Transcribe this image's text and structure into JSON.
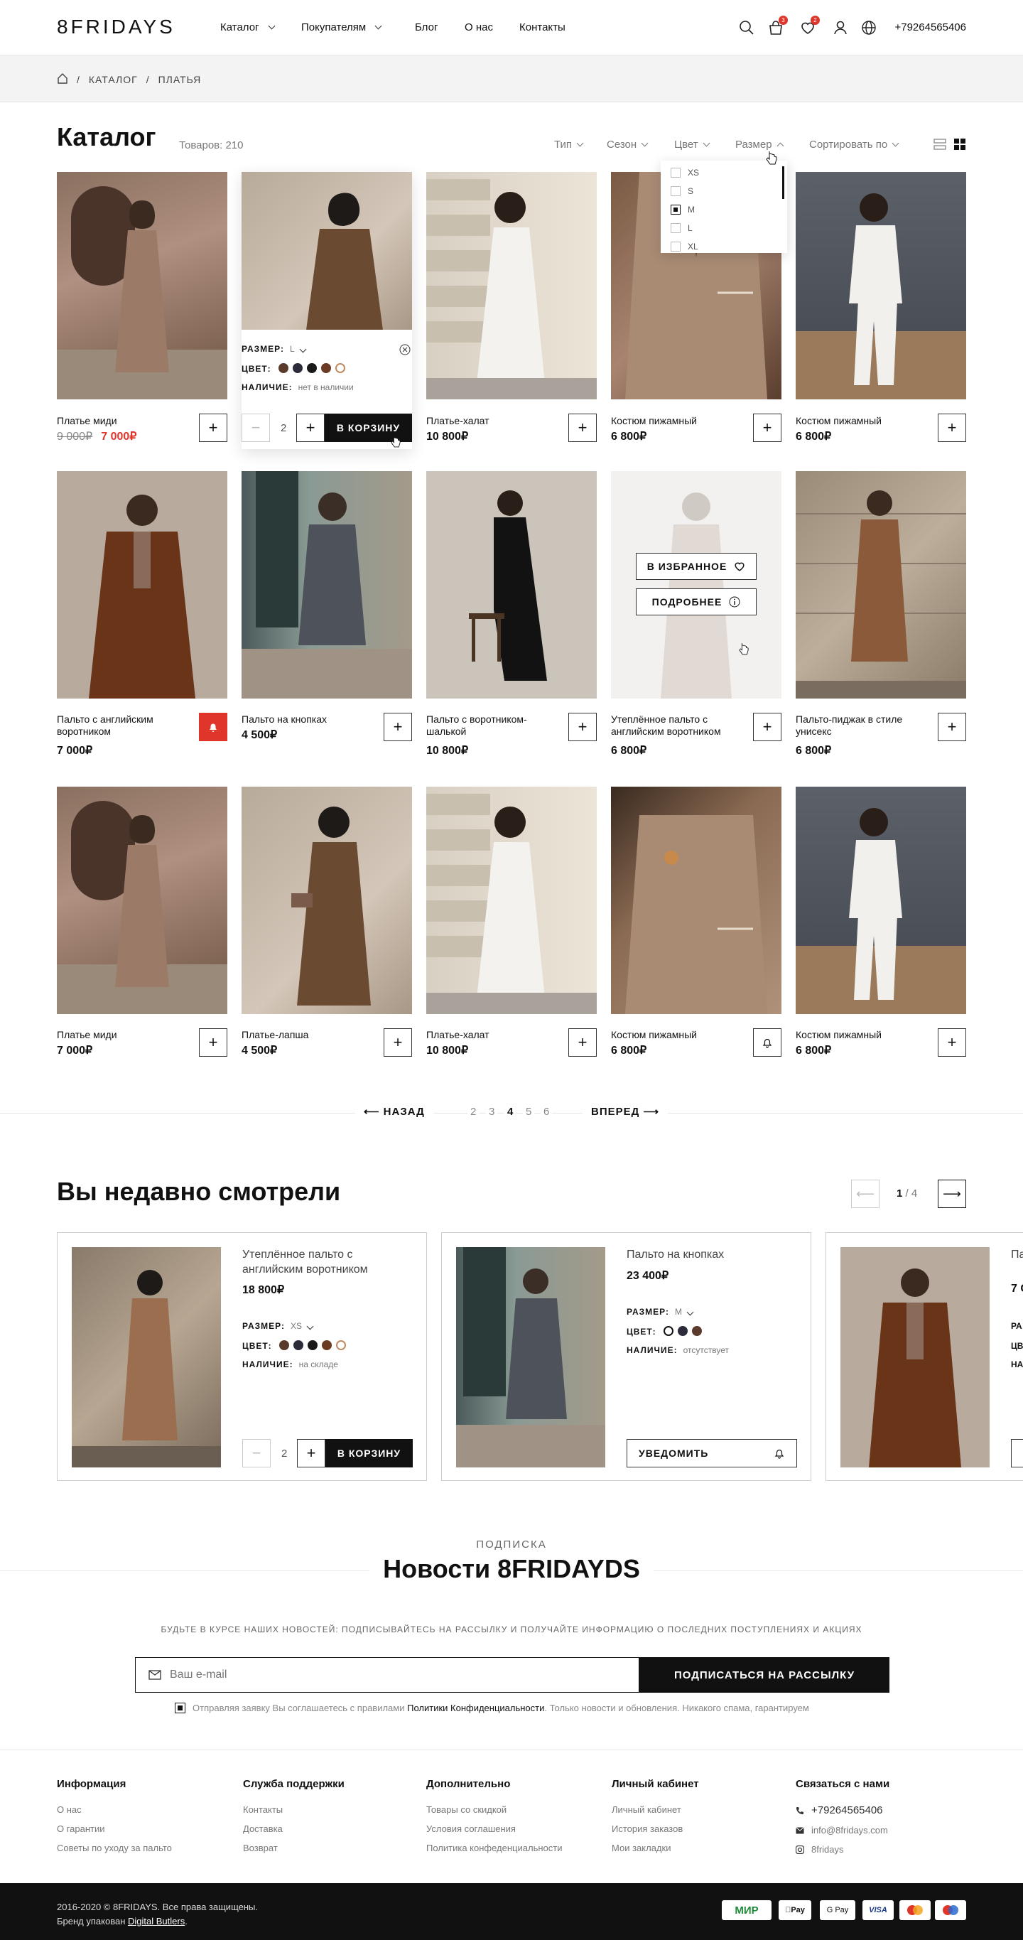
{
  "header": {
    "logo": "8FRIDAYS",
    "nav": [
      "Каталог",
      "Покупателям",
      "Блог",
      "О нас",
      "Контакты"
    ],
    "cart_badge": "3",
    "fav_badge": "2",
    "phone": "+79264565406"
  },
  "breadcrumbs": [
    "КАТАЛОГ",
    "ПЛАТЬЯ"
  ],
  "catalog": {
    "title": "Каталог",
    "count": "Товаров: 210",
    "filters": [
      "Тип",
      "Сезон",
      "Цвет",
      "Размер",
      "Сортировать по"
    ],
    "size_options": [
      {
        "label": "XS",
        "checked": false
      },
      {
        "label": "S",
        "checked": false
      },
      {
        "label": "M",
        "checked": true
      },
      {
        "label": "L",
        "checked": false
      },
      {
        "label": "XL",
        "checked": false
      }
    ]
  },
  "products": [
    {
      "name": "Платье миди",
      "old_price": "9 000₽",
      "price": "7 000₽"
    },
    {
      "name": "",
      "price": "",
      "size_label": "РАЗМЕР:",
      "size_value": "L",
      "color_label": "ЦВЕТ:",
      "stock_label": "НАЛИЧИЕ:",
      "stock_value": "нет в наличии",
      "qty": "2",
      "cart_label": "В КОРЗИНУ"
    },
    {
      "name": "Платье-халат",
      "price": "10 800₽"
    },
    {
      "name": "Костюм пижамный",
      "price": "6 800₽"
    },
    {
      "name": "Костюм пижамный",
      "price": "6 800₽"
    },
    {
      "name": "Пальто с английским воротником",
      "price": "7 000₽"
    },
    {
      "name": "Пальто на кнопках",
      "price": "4 500₽"
    },
    {
      "name": "Пальто с воротником-шалькой",
      "price": "10 800₽"
    },
    {
      "name": "Утеплённое пальто с английским воротником",
      "price": "6 800₽",
      "fav_label": "В ИЗБРАННОЕ",
      "more_label": "ПОДРОБНЕЕ"
    },
    {
      "name": "Пальто-пиджак в стиле унисекс",
      "price": "6 800₽"
    },
    {
      "name": "Платье миди",
      "price": "7 000₽"
    },
    {
      "name": "Платье-лапша",
      "price": "4 500₽"
    },
    {
      "name": "Платье-халат",
      "price": "10 800₽"
    },
    {
      "name": "Костюм пижамный",
      "price": "6 800₽"
    },
    {
      "name": "Костюм пижамный",
      "price": "6 800₽"
    }
  ],
  "pagination": {
    "back": "НАЗАД",
    "next": "ВПЕРЕД",
    "pages": [
      "2",
      "3",
      "4",
      "5",
      "6"
    ],
    "current": "4"
  },
  "recent": {
    "title": "Вы недавно смотрели",
    "page": "1",
    "total": "/ 4",
    "items": [
      {
        "name": "Утеплённое пальто с английским воротником",
        "price": "18 800₽",
        "size_label": "РАЗМЕР:",
        "size_value": "XS",
        "color_label": "ЦВЕТ:",
        "stock_label": "НАЛИЧИЕ:",
        "stock_value": "на складе",
        "qty": "2",
        "cart_label": "В КОРЗИНУ"
      },
      {
        "name": "Пальто на кнопках",
        "price": "23 400₽",
        "size_label": "РАЗМЕР:",
        "size_value": "M",
        "color_label": "ЦВЕТ:",
        "stock_label": "НАЛИЧИЕ:",
        "stock_value": "отсутствует",
        "notify_label": "УВЕДОМИТЬ"
      },
      {
        "name": "Па во",
        "price": "7 С",
        "size_label": "РА",
        "color_label": "ЦВ",
        "stock_label": "НА"
      }
    ]
  },
  "subscribe": {
    "kicker": "ПОДПИСКА",
    "title": "Новости 8FRIDAYDS",
    "desc": "БУДЬТЕ В КУРСЕ НАШИХ НОВОСТЕЙ: ПОДПИСЫВАЙТЕСЬ НА РАССЫЛКУ И ПОЛУЧАЙТЕ ИНФОРМАЦИЮ О ПОСЛЕДНИХ ПОСТУПЛЕНИЯХ И АКЦИЯХ",
    "placeholder": "Ваш e-mail",
    "button": "ПОДПИСАТЬСЯ НА РАССЫЛКУ",
    "consent_pre": "Отправляя заявку Вы соглашаетесь с правилами",
    "consent_link": "Политики Конфиденциальности",
    "consent_post": ". Только новости и обновления. Никакого спама, гарантируем"
  },
  "footer": {
    "cols": [
      {
        "title": "Информация",
        "links": [
          "О нас",
          "О гарантии",
          "Советы по уходу за пальто"
        ]
      },
      {
        "title": "Служба поддержки",
        "links": [
          "Контакты",
          "Доставка",
          "Возврат"
        ]
      },
      {
        "title": "Дополнительно",
        "links": [
          "Товары со скидкой",
          "Условия соглашения",
          "Политика конфеденциальности"
        ]
      },
      {
        "title": "Личный кабинет",
        "links": [
          "Личный кабинет",
          "История заказов",
          "Мои закладки"
        ]
      },
      {
        "title": "Связаться с нами",
        "links": [
          "+79264565406",
          "info@8fridays.com",
          "8fridays"
        ]
      }
    ],
    "copyright": "2016-2020 © 8FRIDAYS. Все права защищены.",
    "brand_pre": "Бренд упакован",
    "brand_link": "Digital Butlers",
    "brand_post": ".",
    "payments": [
      "МИР",
      "Pay",
      "G Pay",
      "VISA",
      "MC",
      "MC"
    ]
  },
  "colors": {
    "accent_red": "#e0352b",
    "dark": "#111111",
    "swatches": [
      "#5a3a2a",
      "#2b2b3a",
      "#1a1a1a",
      "#6a3b22",
      "#ffffff"
    ]
  },
  "icons": [
    "search-icon",
    "cart-icon",
    "heart-icon",
    "user-icon",
    "globe-icon",
    "home-icon",
    "list-view-icon",
    "grid-view-icon",
    "plus-icon",
    "bell-icon",
    "close-icon",
    "info-icon",
    "mail-icon",
    "phone-icon",
    "instagram-icon"
  ]
}
